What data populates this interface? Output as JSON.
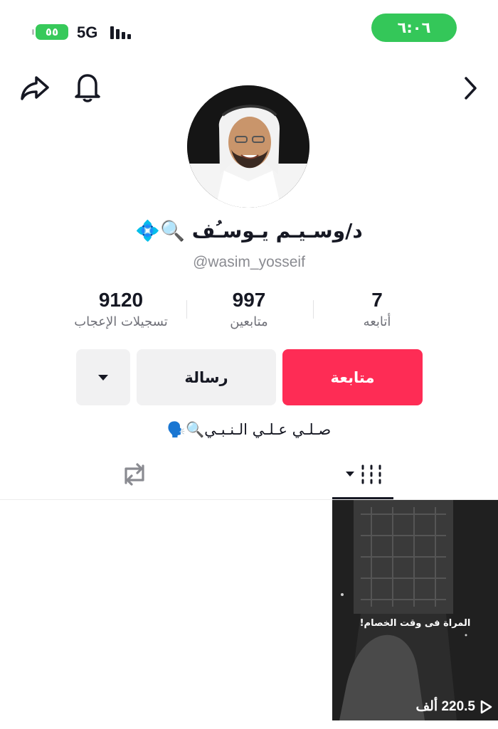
{
  "status_bar": {
    "battery_text": "٥٥",
    "network": "5G",
    "time": "٦:٠٦"
  },
  "profile": {
    "display_name": "د/وسـيـم يـوسـُف",
    "username": "@wasim_yosseif",
    "bio": "صـلـي عـلـي الـنـبـي",
    "stats": [
      {
        "value": "7",
        "label": "أتابعه"
      },
      {
        "value": "997",
        "label": "متابعين"
      },
      {
        "value": "9120",
        "label": "تسجيلات الإعجاب"
      }
    ]
  },
  "actions": {
    "follow_label": "متابعة",
    "message_label": "رسالة"
  },
  "video": {
    "overlay_title": "المراة فى وقت الخصام!",
    "views": "220.5 ألف"
  },
  "colors": {
    "follow_red": "#fe2c55",
    "status_green": "#34c759",
    "button_gray": "#f1f1f2",
    "secondary_text": "#8a8b91"
  },
  "icons": [
    "share-icon",
    "bell-icon",
    "chevron-right-icon",
    "search-emoji-icon",
    "diamond-emoji-icon",
    "speaking-head-icon",
    "grid-icon",
    "repost-icon",
    "play-icon"
  ]
}
